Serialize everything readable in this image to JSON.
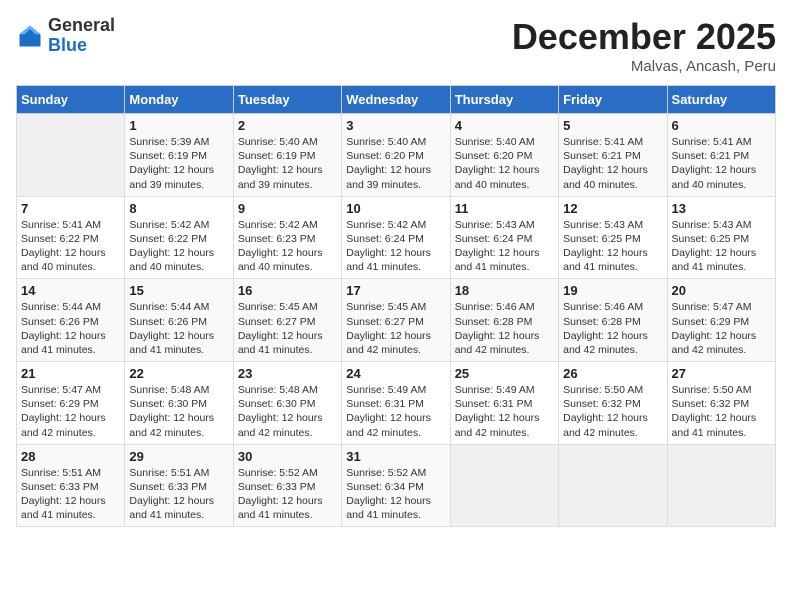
{
  "header": {
    "logo_general": "General",
    "logo_blue": "Blue",
    "month_title": "December 2025",
    "location": "Malvas, Ancash, Peru"
  },
  "calendar": {
    "days_of_week": [
      "Sunday",
      "Monday",
      "Tuesday",
      "Wednesday",
      "Thursday",
      "Friday",
      "Saturday"
    ],
    "weeks": [
      [
        {
          "day": "",
          "sunrise": "",
          "sunset": "",
          "daylight": "",
          "empty": true
        },
        {
          "day": "1",
          "sunrise": "Sunrise: 5:39 AM",
          "sunset": "Sunset: 6:19 PM",
          "daylight": "Daylight: 12 hours and 39 minutes."
        },
        {
          "day": "2",
          "sunrise": "Sunrise: 5:40 AM",
          "sunset": "Sunset: 6:19 PM",
          "daylight": "Daylight: 12 hours and 39 minutes."
        },
        {
          "day": "3",
          "sunrise": "Sunrise: 5:40 AM",
          "sunset": "Sunset: 6:20 PM",
          "daylight": "Daylight: 12 hours and 39 minutes."
        },
        {
          "day": "4",
          "sunrise": "Sunrise: 5:40 AM",
          "sunset": "Sunset: 6:20 PM",
          "daylight": "Daylight: 12 hours and 40 minutes."
        },
        {
          "day": "5",
          "sunrise": "Sunrise: 5:41 AM",
          "sunset": "Sunset: 6:21 PM",
          "daylight": "Daylight: 12 hours and 40 minutes."
        },
        {
          "day": "6",
          "sunrise": "Sunrise: 5:41 AM",
          "sunset": "Sunset: 6:21 PM",
          "daylight": "Daylight: 12 hours and 40 minutes."
        }
      ],
      [
        {
          "day": "7",
          "sunrise": "Sunrise: 5:41 AM",
          "sunset": "Sunset: 6:22 PM",
          "daylight": "Daylight: 12 hours and 40 minutes."
        },
        {
          "day": "8",
          "sunrise": "Sunrise: 5:42 AM",
          "sunset": "Sunset: 6:22 PM",
          "daylight": "Daylight: 12 hours and 40 minutes."
        },
        {
          "day": "9",
          "sunrise": "Sunrise: 5:42 AM",
          "sunset": "Sunset: 6:23 PM",
          "daylight": "Daylight: 12 hours and 40 minutes."
        },
        {
          "day": "10",
          "sunrise": "Sunrise: 5:42 AM",
          "sunset": "Sunset: 6:24 PM",
          "daylight": "Daylight: 12 hours and 41 minutes."
        },
        {
          "day": "11",
          "sunrise": "Sunrise: 5:43 AM",
          "sunset": "Sunset: 6:24 PM",
          "daylight": "Daylight: 12 hours and 41 minutes."
        },
        {
          "day": "12",
          "sunrise": "Sunrise: 5:43 AM",
          "sunset": "Sunset: 6:25 PM",
          "daylight": "Daylight: 12 hours and 41 minutes."
        },
        {
          "day": "13",
          "sunrise": "Sunrise: 5:43 AM",
          "sunset": "Sunset: 6:25 PM",
          "daylight": "Daylight: 12 hours and 41 minutes."
        }
      ],
      [
        {
          "day": "14",
          "sunrise": "Sunrise: 5:44 AM",
          "sunset": "Sunset: 6:26 PM",
          "daylight": "Daylight: 12 hours and 41 minutes."
        },
        {
          "day": "15",
          "sunrise": "Sunrise: 5:44 AM",
          "sunset": "Sunset: 6:26 PM",
          "daylight": "Daylight: 12 hours and 41 minutes."
        },
        {
          "day": "16",
          "sunrise": "Sunrise: 5:45 AM",
          "sunset": "Sunset: 6:27 PM",
          "daylight": "Daylight: 12 hours and 41 minutes."
        },
        {
          "day": "17",
          "sunrise": "Sunrise: 5:45 AM",
          "sunset": "Sunset: 6:27 PM",
          "daylight": "Daylight: 12 hours and 42 minutes."
        },
        {
          "day": "18",
          "sunrise": "Sunrise: 5:46 AM",
          "sunset": "Sunset: 6:28 PM",
          "daylight": "Daylight: 12 hours and 42 minutes."
        },
        {
          "day": "19",
          "sunrise": "Sunrise: 5:46 AM",
          "sunset": "Sunset: 6:28 PM",
          "daylight": "Daylight: 12 hours and 42 minutes."
        },
        {
          "day": "20",
          "sunrise": "Sunrise: 5:47 AM",
          "sunset": "Sunset: 6:29 PM",
          "daylight": "Daylight: 12 hours and 42 minutes."
        }
      ],
      [
        {
          "day": "21",
          "sunrise": "Sunrise: 5:47 AM",
          "sunset": "Sunset: 6:29 PM",
          "daylight": "Daylight: 12 hours and 42 minutes."
        },
        {
          "day": "22",
          "sunrise": "Sunrise: 5:48 AM",
          "sunset": "Sunset: 6:30 PM",
          "daylight": "Daylight: 12 hours and 42 minutes."
        },
        {
          "day": "23",
          "sunrise": "Sunrise: 5:48 AM",
          "sunset": "Sunset: 6:30 PM",
          "daylight": "Daylight: 12 hours and 42 minutes."
        },
        {
          "day": "24",
          "sunrise": "Sunrise: 5:49 AM",
          "sunset": "Sunset: 6:31 PM",
          "daylight": "Daylight: 12 hours and 42 minutes."
        },
        {
          "day": "25",
          "sunrise": "Sunrise: 5:49 AM",
          "sunset": "Sunset: 6:31 PM",
          "daylight": "Daylight: 12 hours and 42 minutes."
        },
        {
          "day": "26",
          "sunrise": "Sunrise: 5:50 AM",
          "sunset": "Sunset: 6:32 PM",
          "daylight": "Daylight: 12 hours and 42 minutes."
        },
        {
          "day": "27",
          "sunrise": "Sunrise: 5:50 AM",
          "sunset": "Sunset: 6:32 PM",
          "daylight": "Daylight: 12 hours and 41 minutes."
        }
      ],
      [
        {
          "day": "28",
          "sunrise": "Sunrise: 5:51 AM",
          "sunset": "Sunset: 6:33 PM",
          "daylight": "Daylight: 12 hours and 41 minutes."
        },
        {
          "day": "29",
          "sunrise": "Sunrise: 5:51 AM",
          "sunset": "Sunset: 6:33 PM",
          "daylight": "Daylight: 12 hours and 41 minutes."
        },
        {
          "day": "30",
          "sunrise": "Sunrise: 5:52 AM",
          "sunset": "Sunset: 6:33 PM",
          "daylight": "Daylight: 12 hours and 41 minutes."
        },
        {
          "day": "31",
          "sunrise": "Sunrise: 5:52 AM",
          "sunset": "Sunset: 6:34 PM",
          "daylight": "Daylight: 12 hours and 41 minutes."
        },
        {
          "day": "",
          "sunrise": "",
          "sunset": "",
          "daylight": "",
          "empty": true
        },
        {
          "day": "",
          "sunrise": "",
          "sunset": "",
          "daylight": "",
          "empty": true
        },
        {
          "day": "",
          "sunrise": "",
          "sunset": "",
          "daylight": "",
          "empty": true
        }
      ]
    ]
  }
}
